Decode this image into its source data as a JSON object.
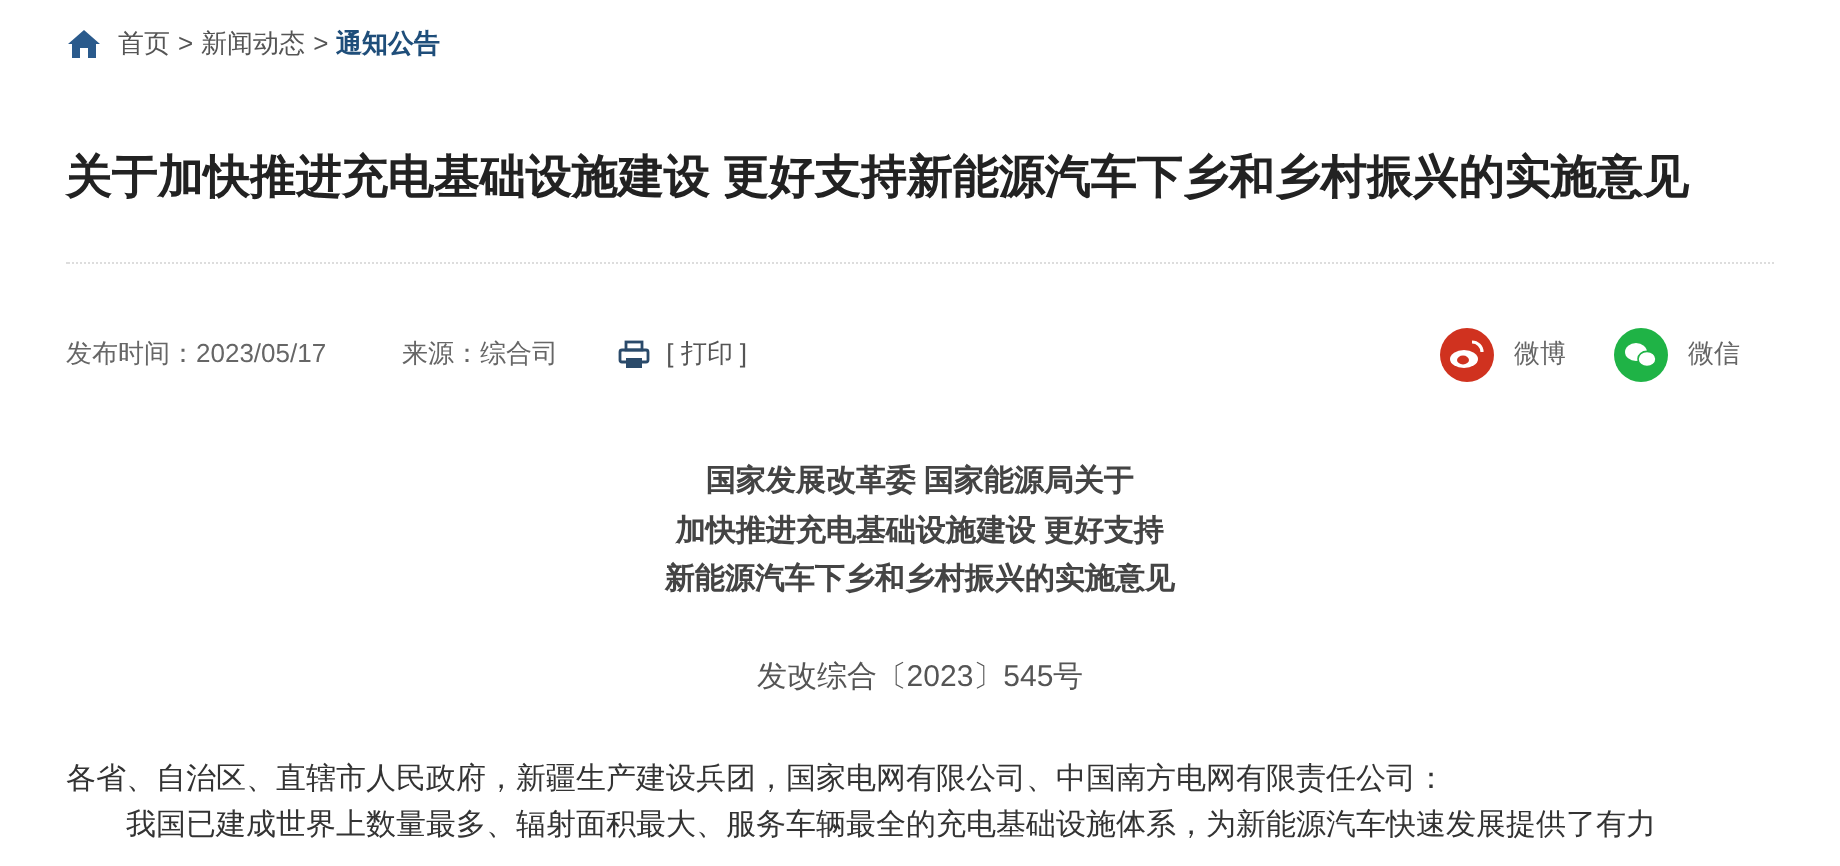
{
  "breadcrumb": [
    {
      "label": "首页",
      "current": false,
      "separator": ">"
    },
    {
      "label": "新闻动态",
      "current": false,
      "separator": ">"
    },
    {
      "label": "通知公告",
      "current": true
    }
  ],
  "title": "关于加快推进充电基础设施建设 更好支持新能源汽车下乡和乡村振兴的实施意见",
  "meta": {
    "published": "发布时间：2023/05/17",
    "source": "来源：综合司",
    "print": "[ 打印 ]"
  },
  "share": [
    {
      "kind": "weibo",
      "label": "微博",
      "color": "#d0321f"
    },
    {
      "kind": "wechat",
      "label": "微信",
      "color": "#1fb346"
    }
  ],
  "doc_title": [
    "国家发展改革委 国家能源局关于",
    "加快推进充电基础设施建设 更好支持",
    "新能源汽车下乡和乡村振兴的实施意见"
  ],
  "doc_number": "发改综合〔2023〕545号",
  "paragraphs": [
    {
      "text": "各省、自治区、直辖市人民政府，新疆生产建设兵团，国家电网有限公司、中国南方电网有限责任公司：",
      "indent": false
    },
    {
      "text": "我国已建成世界上数量最多、辐射面积最大、服务车辆最全的充电基础设施体系，为新能源汽车快速发展提供了有力",
      "indent": true
    }
  ]
}
